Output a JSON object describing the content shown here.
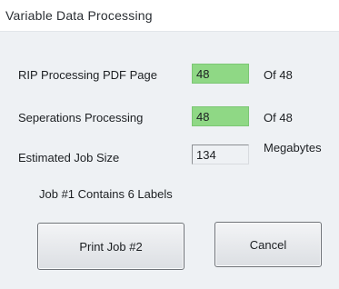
{
  "window": {
    "title": "Variable Data Processing"
  },
  "rows": {
    "rip": {
      "label": "RIP Processing PDF Page",
      "value": "48",
      "suffix": "Of 48"
    },
    "separations": {
      "label": "Seperations Processing",
      "value": "48",
      "suffix": "Of 48"
    },
    "job_size": {
      "label": "Estimated Job Size",
      "value": "134",
      "suffix": "Megabytes"
    }
  },
  "job_info": "Job #1 Contains 6 Labels",
  "buttons": {
    "print_label": "Print Job #2",
    "cancel_label": "Cancel"
  },
  "colors": {
    "progress_field": "#8fd885",
    "background": "#eef1f4"
  }
}
